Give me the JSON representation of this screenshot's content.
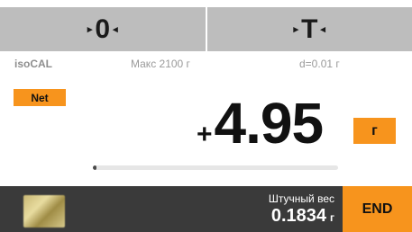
{
  "top_buttons": {
    "zero": {
      "label": "0",
      "arrow_left": "▸",
      "arrow_right": "◂"
    },
    "tare": {
      "label": "T",
      "arrow_left": "▸",
      "arrow_right": "◂"
    }
  },
  "info": {
    "mode": "isoCAL",
    "max_capacity": "Макс 2100 г",
    "division": "d=0.01 г"
  },
  "net_badge": "Net",
  "reading": {
    "sign": "+",
    "value": "4.95",
    "unit": "г"
  },
  "capacity_bar": {
    "fraction": 0.0024
  },
  "bottom": {
    "piece_weight_label": "Штучный вес",
    "piece_weight_value": "0.1834",
    "piece_weight_unit": "г",
    "end_label": "END"
  },
  "colors": {
    "accent": "#f7941d",
    "top_button_bg": "#bdbdbd",
    "bottom_bar_bg": "#3a3a3a"
  }
}
